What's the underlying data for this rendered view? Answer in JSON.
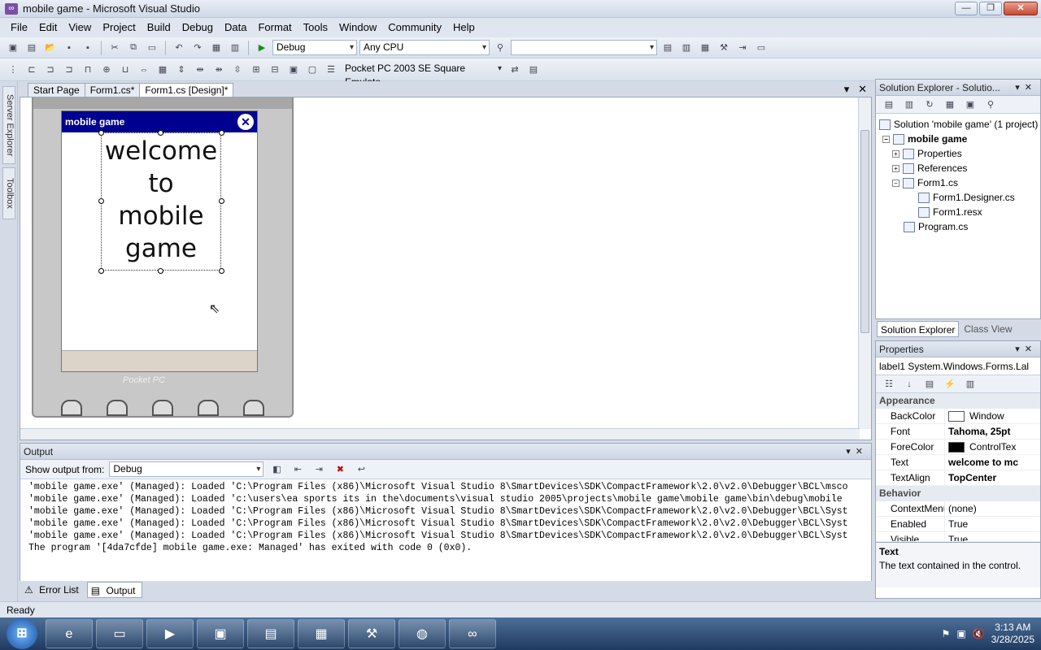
{
  "window": {
    "title": "mobile game - Microsoft Visual Studio"
  },
  "menu": [
    "File",
    "Edit",
    "View",
    "Project",
    "Build",
    "Debug",
    "Data",
    "Format",
    "Tools",
    "Window",
    "Community",
    "Help"
  ],
  "toolbar": {
    "config": "Debug",
    "platform": "Any CPU",
    "device": "Pocket PC 2003 SE Square Emulato"
  },
  "sidebar_tabs": {
    "server_explorer": "Server Explorer",
    "toolbox": "Toolbox"
  },
  "doc_tabs": [
    "Start Page",
    "Form1.cs*",
    "Form1.cs [Design]*"
  ],
  "form": {
    "title": "mobile game",
    "label_text": "welcome to mobile game",
    "brand": "Pocket PC"
  },
  "solution_explorer": {
    "header": "Solution Explorer - Solutio...",
    "items": [
      "Solution 'mobile game' (1 project)",
      "mobile game",
      "Properties",
      "References",
      "Form1.cs",
      "Form1.Designer.cs",
      "Form1.resx",
      "Program.cs"
    ],
    "tabs": [
      "Solution Explorer",
      "Class View"
    ]
  },
  "properties": {
    "header": "Properties",
    "object": "label1 System.Windows.Forms.Lal",
    "categories": {
      "appearance": "Appearance",
      "behavior": "Behavior"
    },
    "rows_appearance": [
      {
        "name": "BackColor",
        "value": "Window"
      },
      {
        "name": "Font",
        "value": "Tahoma, 25pt"
      },
      {
        "name": "ForeColor",
        "value": "ControlTex"
      },
      {
        "name": "Text",
        "value": "welcome to mc"
      },
      {
        "name": "TextAlign",
        "value": "TopCenter"
      }
    ],
    "rows_behavior": [
      {
        "name": "ContextMenu",
        "value": "(none)"
      },
      {
        "name": "Enabled",
        "value": "True"
      },
      {
        "name": "Visible",
        "value": "True"
      }
    ],
    "desc_title": "Text",
    "desc_text": "The text contained in the control."
  },
  "output": {
    "header": "Output",
    "show_from_label": "Show output from:",
    "show_from_value": "Debug",
    "lines": [
      "'mobile game.exe' (Managed): Loaded 'C:\\Program Files (x86)\\Microsoft Visual Studio 8\\SmartDevices\\SDK\\CompactFramework\\2.0\\v2.0\\Debugger\\BCL\\msco",
      "'mobile game.exe' (Managed): Loaded 'c:\\users\\ea sports its in the\\documents\\visual studio 2005\\projects\\mobile game\\mobile game\\bin\\debug\\mobile",
      "'mobile game.exe' (Managed): Loaded 'C:\\Program Files (x86)\\Microsoft Visual Studio 8\\SmartDevices\\SDK\\CompactFramework\\2.0\\v2.0\\Debugger\\BCL\\Syst",
      "'mobile game.exe' (Managed): Loaded 'C:\\Program Files (x86)\\Microsoft Visual Studio 8\\SmartDevices\\SDK\\CompactFramework\\2.0\\v2.0\\Debugger\\BCL\\Syst",
      "'mobile game.exe' (Managed): Loaded 'C:\\Program Files (x86)\\Microsoft Visual Studio 8\\SmartDevices\\SDK\\CompactFramework\\2.0\\v2.0\\Debugger\\BCL\\Syst",
      "The program '[4da7cfde] mobile game.exe: Managed' has exited with code 0 (0x0)."
    ]
  },
  "bottom_tabs": [
    "Error List",
    "Output"
  ],
  "status": "Ready",
  "clock": {
    "time": "3:13 AM",
    "date": "3/28/2025"
  },
  "colors": {
    "form_title": "#000090",
    "window_close": "#c64a33"
  }
}
